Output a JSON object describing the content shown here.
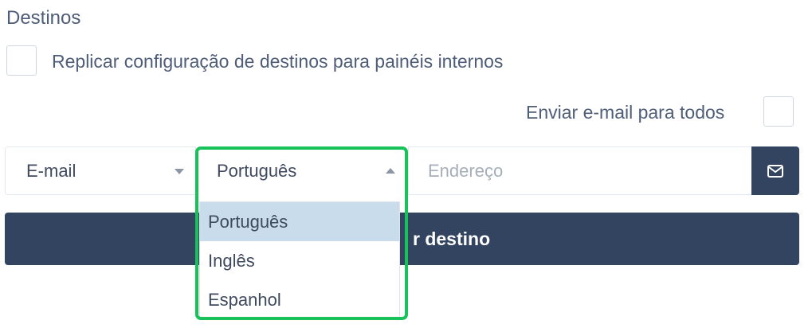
{
  "section": {
    "title": "Destinos"
  },
  "replicar": {
    "label": "Replicar configuração de destinos para painéis internos",
    "checked": false
  },
  "enviar_todos": {
    "label": "Enviar e-mail para todos",
    "checked": false
  },
  "destination_form": {
    "type_select": {
      "value": "E-mail"
    },
    "language_select": {
      "value": "Português",
      "open": true,
      "options": [
        "Português",
        "Inglês",
        "Espanhol"
      ],
      "highlighted_option": "Português"
    },
    "address_input": {
      "value": "",
      "placeholder": "Endereço"
    },
    "send_icon": "envelope-icon"
  },
  "add_button": {
    "visible_label": "r destino"
  },
  "colors": {
    "primary_dark": "#334460",
    "highlight_frame": "#18c15a",
    "option_highlight": "#c8dcec"
  }
}
